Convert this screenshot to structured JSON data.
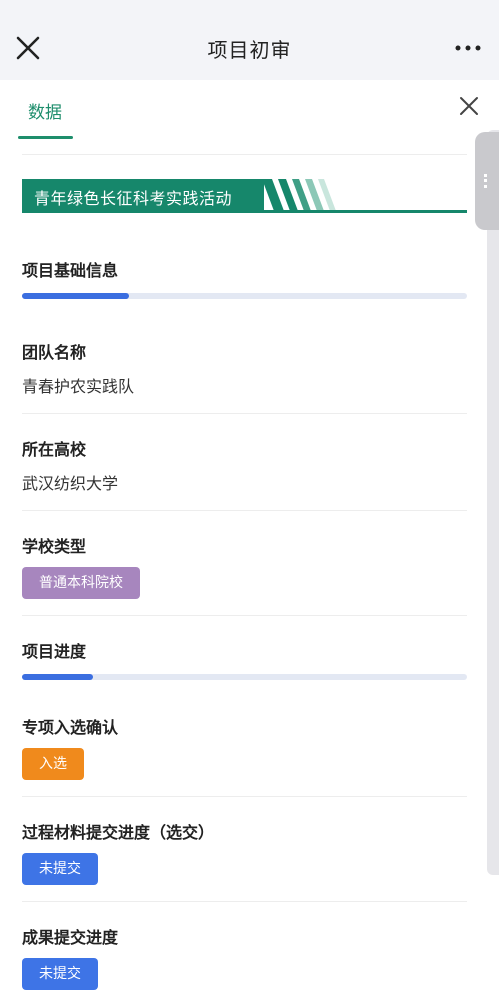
{
  "header": {
    "title": "项目初审"
  },
  "tabs": [
    {
      "label": "数据"
    }
  ],
  "banner": {
    "text": "青年绿色长征科考实践活动"
  },
  "sections": {
    "basic": {
      "title": "项目基础信息",
      "progress": 0.24
    },
    "progress": {
      "title": "项目进度",
      "progress": 0.16
    }
  },
  "fields": {
    "team_name": {
      "label": "团队名称",
      "value": "青春护农实践队"
    },
    "school": {
      "label": "所在高校",
      "value": "武汉纺织大学"
    },
    "school_type": {
      "label": "学校类型",
      "value": "普通本科院校"
    },
    "special_confirm": {
      "label": "专项入选确认",
      "value": "入选"
    },
    "material_progress": {
      "label": "过程材料提交进度（选交）",
      "value": "未提交"
    },
    "result_progress": {
      "label": "成果提交进度",
      "value": "未提交"
    }
  },
  "colors": {
    "accent_green": "#16876b",
    "progress_blue": "#3b6ee0",
    "tag_purple": "#a786be",
    "tag_orange": "#f08a1c",
    "tag_blue": "#3e74e6"
  },
  "icons": {
    "page_close": "close-icon",
    "more": "more-horizontal-icon",
    "sheet_close": "close-icon"
  }
}
